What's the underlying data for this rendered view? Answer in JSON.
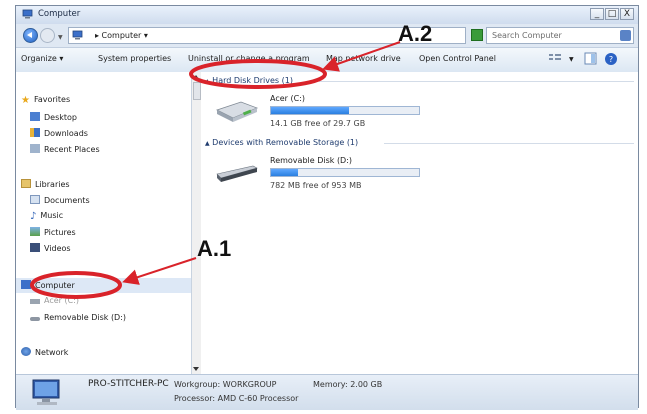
{
  "window": {
    "title": "Computer",
    "controls": {
      "minimize": "_",
      "maximize": "□",
      "close": "X"
    }
  },
  "address": {
    "path": "▸ Computer ▾",
    "search_placeholder": "Search Computer"
  },
  "toolbar": {
    "organize": "Organize ▾",
    "system_properties": "System properties",
    "uninstall": "Uninstall or change a program",
    "map_drive": "Map network drive",
    "control_panel": "Open Control Panel"
  },
  "sidebar": {
    "favorites": {
      "label": "Favorites",
      "items": [
        {
          "label": "Desktop"
        },
        {
          "label": "Downloads"
        },
        {
          "label": "Recent Places"
        }
      ]
    },
    "libraries": {
      "label": "Libraries",
      "items": [
        {
          "label": "Documents"
        },
        {
          "label": "Music"
        },
        {
          "label": "Pictures"
        },
        {
          "label": "Videos"
        }
      ]
    },
    "computer": {
      "label": "Computer",
      "items": [
        {
          "label": "Acer (C:)"
        },
        {
          "label": "Removable Disk (D:)"
        }
      ]
    },
    "network": {
      "label": "Network"
    }
  },
  "content": {
    "hard_disk_header": "Hard Disk Drives (1)",
    "removable_header": "Devices with Removable Storage (1)",
    "drives": [
      {
        "name": "Acer (C:)",
        "free_text": "14.1 GB free of 29.7 GB",
        "used_fraction": 0.525
      },
      {
        "name": "Removable Disk (D:)",
        "free_text": "782 MB free of 953 MB",
        "used_fraction": 0.18
      }
    ]
  },
  "details": {
    "pc_name": "PRO-STITCHER-PC",
    "workgroup": "Workgroup: WORKGROUP",
    "memory": "Memory: 2.00 GB",
    "processor": "Processor: AMD C-60 Processor"
  },
  "annotations": {
    "a1": "A.1",
    "a2": "A.2"
  },
  "colors": {
    "annotation_red": "#d9232a",
    "drive_fill": "#2a7fe0"
  }
}
